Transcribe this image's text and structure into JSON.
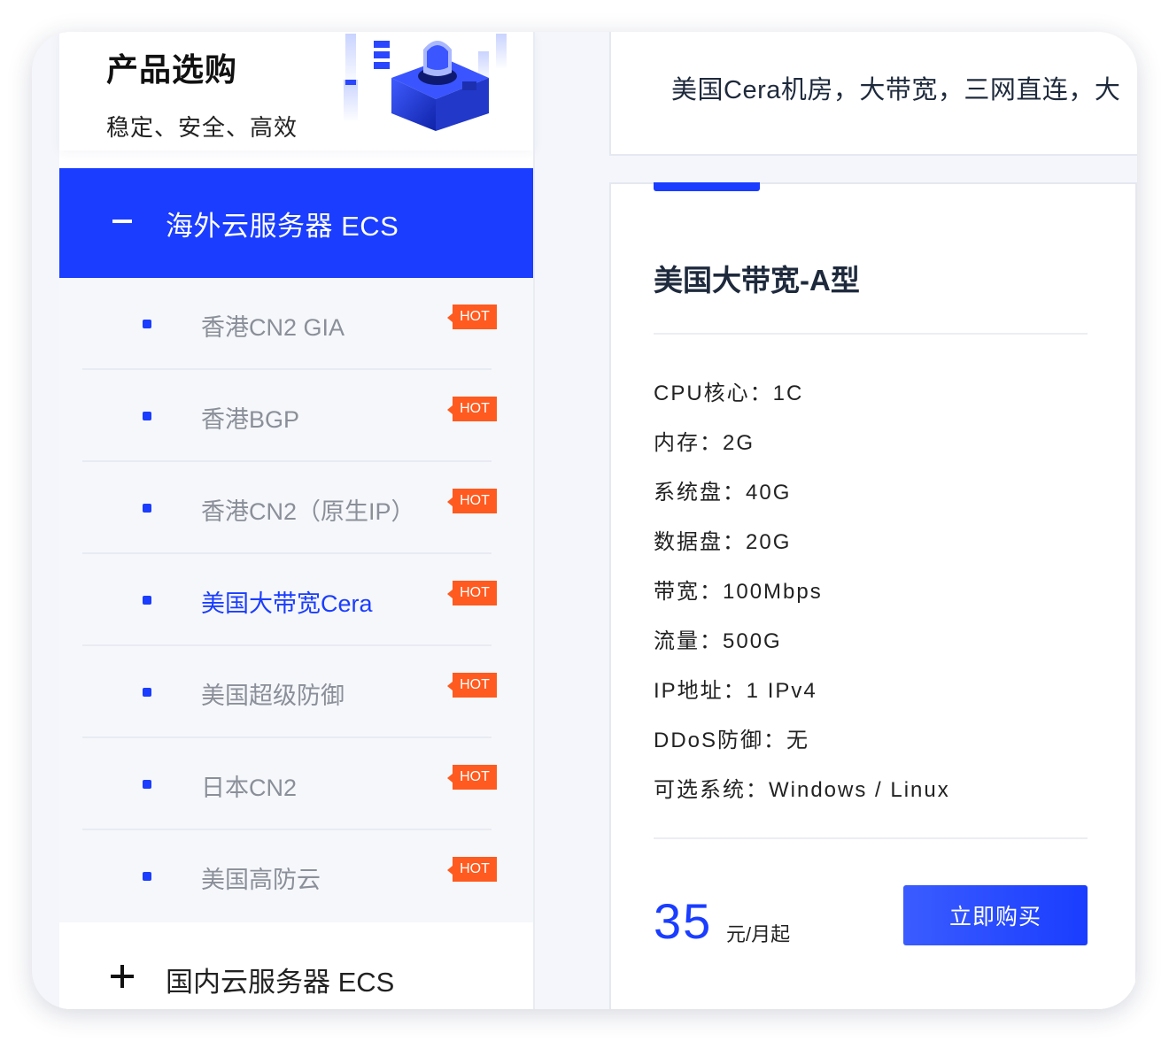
{
  "sidebar": {
    "title": "产品选购",
    "subtitle": "稳定、安全、高效",
    "active_group": {
      "label": "海外云服务器 ECS"
    },
    "items": [
      {
        "label": "香港CN2 GIA",
        "badge": "HOT"
      },
      {
        "label": "香港BGP",
        "badge": "HOT"
      },
      {
        "label": "香港CN2（原生IP）",
        "badge": "HOT"
      },
      {
        "label": "美国大带宽Cera",
        "badge": "HOT"
      },
      {
        "label": "美国超级防御",
        "badge": "HOT"
      },
      {
        "label": "日本CN2",
        "badge": "HOT"
      },
      {
        "label": "美国高防云",
        "badge": "HOT"
      }
    ],
    "next_group": {
      "label": "国内云服务器 ECS"
    }
  },
  "banner": {
    "text": "美国Cera机房，大带宽，三网直连，大"
  },
  "card": {
    "title": "美国大带宽-A型",
    "specs": [
      "CPU核心：1C",
      "内存：2G",
      "系统盘：40G",
      "数据盘：20G",
      "带宽：100Mbps",
      "流量：500G",
      "IP地址：1 IPv4",
      "DDoS防御：无",
      "可选系统：Windows / Linux"
    ],
    "price": "35",
    "price_unit": "元/月起",
    "buy_label": "立即购买"
  },
  "colors": {
    "accent": "#1a3dff",
    "hot_badge": "#ff5a1f"
  },
  "icons": {
    "collapse": "minus-icon",
    "expand": "plus-icon",
    "bullet": "square-bullet-icon"
  }
}
